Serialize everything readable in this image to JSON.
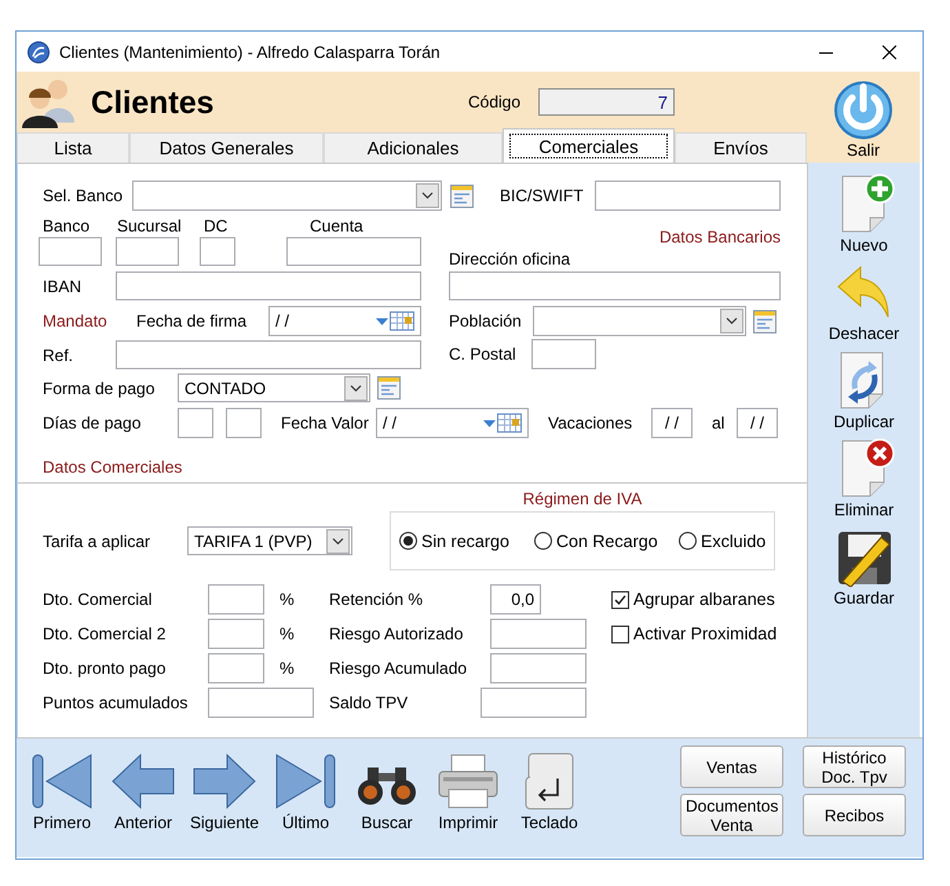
{
  "window": {
    "title": "Clientes (Mantenimiento) - Alfredo Calasparra Torán"
  },
  "header": {
    "title": "Clientes",
    "code_label": "Código",
    "code_value": "7"
  },
  "tabs": [
    {
      "label": "Lista",
      "selected": false
    },
    {
      "label": "Datos Generales",
      "selected": false
    },
    {
      "label": "Adicionales",
      "selected": false
    },
    {
      "label": "Comerciales",
      "selected": true
    },
    {
      "label": "Envíos",
      "selected": false
    }
  ],
  "bank": {
    "bank_select_label": "Sel. Banco",
    "bic_label": "BIC/SWIFT",
    "account_labels": [
      "Banco",
      "Sucursal",
      "DC",
      "Cuenta"
    ],
    "heading": "Datos Bancarios",
    "office_address_label": "Dirección oficina",
    "iban_label": "IBAN",
    "mandate_label": "Mandato",
    "signature_date": {
      "label": "Fecha de firma",
      "value": "/ /"
    },
    "town_label": "Población",
    "ref_label": "Ref.",
    "postcode_label": "C. Postal",
    "payment_method": {
      "label": "Forma de pago",
      "value": "CONTADO"
    },
    "payment_days_label": "Días de pago",
    "value_date": {
      "label": "Fecha Valor",
      "value": "/ /"
    },
    "holidays": {
      "label": "Vacaciones",
      "from": "/ /",
      "to_label": "al",
      "to": "/ /"
    }
  },
  "commercial": {
    "heading": "Datos Comerciales",
    "vat_regime": {
      "title": "Régimen de IVA",
      "options": [
        {
          "label": "Sin recargo",
          "selected": true
        },
        {
          "label": "Con Recargo",
          "selected": false
        },
        {
          "label": "Excluido",
          "selected": false
        }
      ]
    },
    "rate": {
      "label": "Tarifa a aplicar",
      "value": "TARIFA 1 (PVP)"
    },
    "discounts": [
      {
        "label": "Dto. Comercial",
        "unit": "%"
      },
      {
        "label": "Dto. Comercial 2",
        "unit": "%"
      },
      {
        "label": "Dto. pronto pago",
        "unit": "%"
      },
      {
        "label": "Puntos acumulados"
      }
    ],
    "figures": [
      {
        "label": "Retención %",
        "value": "0,0"
      },
      {
        "label": "Riesgo Autorizado"
      },
      {
        "label": "Riesgo Acumulado"
      },
      {
        "label": "Saldo TPV"
      }
    ],
    "options": [
      {
        "label": "Agrupar albaranes",
        "checked": true
      },
      {
        "label": "Activar Proximidad",
        "checked": false
      }
    ]
  },
  "exit": {
    "label": "Salir"
  },
  "side_actions": [
    {
      "kind": "new",
      "label": "Nuevo"
    },
    {
      "kind": "undo",
      "label": "Deshacer"
    },
    {
      "kind": "duplicate",
      "label": "Duplicar"
    },
    {
      "kind": "delete",
      "label": "Eliminar"
    },
    {
      "kind": "save",
      "label": "Guardar"
    }
  ],
  "nav": [
    {
      "kind": "first",
      "label": "Primero"
    },
    {
      "kind": "previous",
      "label": "Anterior"
    },
    {
      "kind": "next",
      "label": "Siguiente"
    },
    {
      "kind": "last",
      "label": "Último"
    },
    {
      "kind": "search",
      "label": "Buscar"
    },
    {
      "kind": "print",
      "label": "Imprimir"
    },
    {
      "kind": "keyboard",
      "label": "Teclado"
    }
  ],
  "buttons": [
    "Ventas",
    "Documentos Venta",
    "Histórico Doc. Tpv",
    "Recibos"
  ]
}
